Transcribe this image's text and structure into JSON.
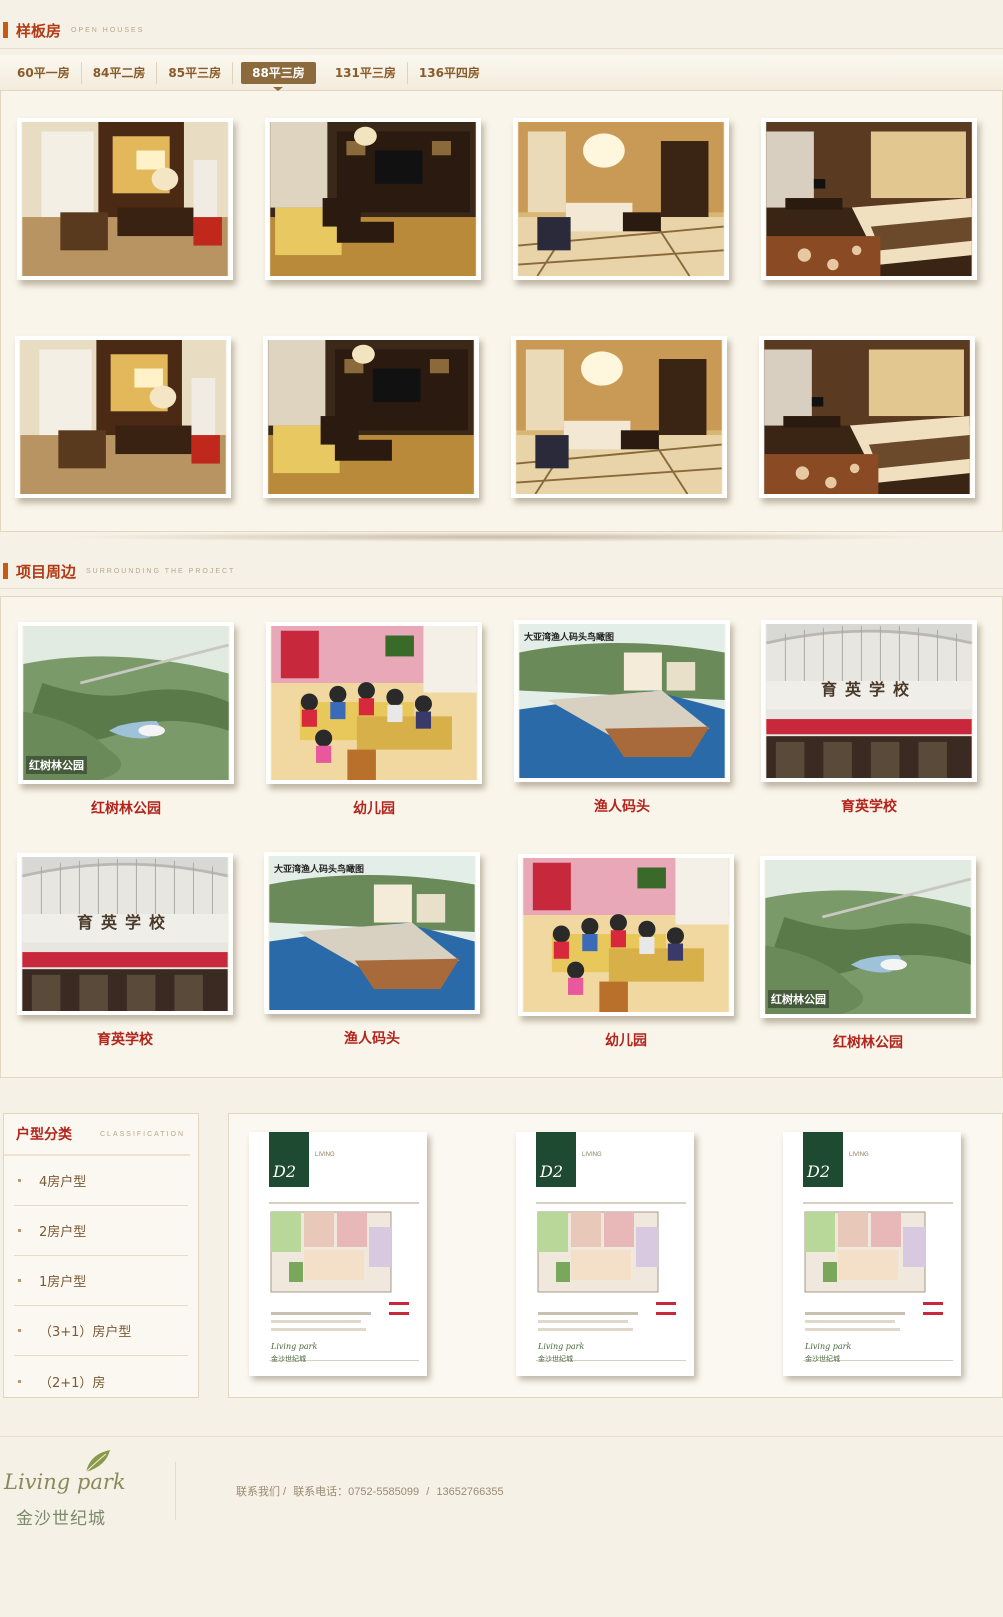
{
  "open_houses": {
    "title": "样板房",
    "subtitle": "OPEN HOUSES",
    "tabs": [
      "60平一房",
      "84平二房",
      "85平三房",
      "88平三房",
      "131平三房",
      "136平四房"
    ],
    "active_tab": "88平三房"
  },
  "surrounding": {
    "title": "项目周边",
    "subtitle": "SURROUNDING THE PROJECT",
    "row1": [
      {
        "caption": "红树林公园",
        "image_text": "红树林公园"
      },
      {
        "caption": "幼儿园",
        "image_text": ""
      },
      {
        "caption": "渔人码头",
        "image_text": "大亚湾渔人码头鸟瞰图"
      },
      {
        "caption": "育英学校",
        "image_text": "育英学校"
      }
    ],
    "row2": [
      {
        "caption": "育英学校",
        "image_text": "育英学校"
      },
      {
        "caption": "渔人码头",
        "image_text": "大亚湾渔人码头鸟瞰图"
      },
      {
        "caption": "幼儿园",
        "image_text": ""
      },
      {
        "caption": "红树林公园",
        "image_text": "红树林公园"
      }
    ]
  },
  "classification": {
    "title": "户型分类",
    "subtitle": "CLASSIFICATION",
    "items": [
      "4房户型",
      "2房户型",
      "1房户型",
      "（3+1）房户型",
      "（2+1）房"
    ]
  },
  "plans": {
    "badge": "D2",
    "living": "LIVING",
    "brand": "Living park",
    "brand_cn": "金沙世纪城"
  },
  "footer": {
    "logo_text": "Living park",
    "logo_cn": "金沙世纪城",
    "contact_us": "联系我们 /",
    "contact_phone_label": "联系电话：0752-5585099",
    "sep": "/",
    "contact_mobile": "13652766355"
  },
  "colors": {
    "accent": "#b2241c",
    "tab_active": "#8c6a3c",
    "background": "#f6f1e6"
  }
}
